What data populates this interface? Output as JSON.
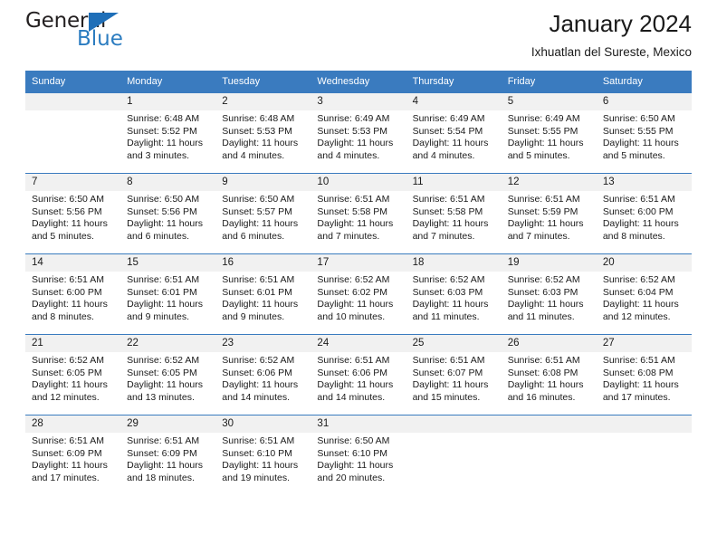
{
  "brand": {
    "name_part1": "General",
    "name_part2": "Blue",
    "triangle_color": "#1f6fb8",
    "blue_color": "#2b7cc0"
  },
  "header": {
    "title": "January 2024",
    "subtitle": "Ixhuatlan del Sureste, Mexico"
  },
  "theme": {
    "header_bg": "#3a7bbf",
    "daynum_bg": "#f1f1f1",
    "grid_line": "#3a7bbf",
    "text": "#1a1a1a"
  },
  "weekday_headers": [
    "Sunday",
    "Monday",
    "Tuesday",
    "Wednesday",
    "Thursday",
    "Friday",
    "Saturday"
  ],
  "weeks": [
    [
      {
        "day": "",
        "sunrise": "",
        "sunset": "",
        "daylight": "",
        "empty": true
      },
      {
        "day": "1",
        "sunrise": "Sunrise: 6:48 AM",
        "sunset": "Sunset: 5:52 PM",
        "daylight": "Daylight: 11 hours and 3 minutes."
      },
      {
        "day": "2",
        "sunrise": "Sunrise: 6:48 AM",
        "sunset": "Sunset: 5:53 PM",
        "daylight": "Daylight: 11 hours and 4 minutes."
      },
      {
        "day": "3",
        "sunrise": "Sunrise: 6:49 AM",
        "sunset": "Sunset: 5:53 PM",
        "daylight": "Daylight: 11 hours and 4 minutes."
      },
      {
        "day": "4",
        "sunrise": "Sunrise: 6:49 AM",
        "sunset": "Sunset: 5:54 PM",
        "daylight": "Daylight: 11 hours and 4 minutes."
      },
      {
        "day": "5",
        "sunrise": "Sunrise: 6:49 AM",
        "sunset": "Sunset: 5:55 PM",
        "daylight": "Daylight: 11 hours and 5 minutes."
      },
      {
        "day": "6",
        "sunrise": "Sunrise: 6:50 AM",
        "sunset": "Sunset: 5:55 PM",
        "daylight": "Daylight: 11 hours and 5 minutes."
      }
    ],
    [
      {
        "day": "7",
        "sunrise": "Sunrise: 6:50 AM",
        "sunset": "Sunset: 5:56 PM",
        "daylight": "Daylight: 11 hours and 5 minutes."
      },
      {
        "day": "8",
        "sunrise": "Sunrise: 6:50 AM",
        "sunset": "Sunset: 5:56 PM",
        "daylight": "Daylight: 11 hours and 6 minutes."
      },
      {
        "day": "9",
        "sunrise": "Sunrise: 6:50 AM",
        "sunset": "Sunset: 5:57 PM",
        "daylight": "Daylight: 11 hours and 6 minutes."
      },
      {
        "day": "10",
        "sunrise": "Sunrise: 6:51 AM",
        "sunset": "Sunset: 5:58 PM",
        "daylight": "Daylight: 11 hours and 7 minutes."
      },
      {
        "day": "11",
        "sunrise": "Sunrise: 6:51 AM",
        "sunset": "Sunset: 5:58 PM",
        "daylight": "Daylight: 11 hours and 7 minutes."
      },
      {
        "day": "12",
        "sunrise": "Sunrise: 6:51 AM",
        "sunset": "Sunset: 5:59 PM",
        "daylight": "Daylight: 11 hours and 7 minutes."
      },
      {
        "day": "13",
        "sunrise": "Sunrise: 6:51 AM",
        "sunset": "Sunset: 6:00 PM",
        "daylight": "Daylight: 11 hours and 8 minutes."
      }
    ],
    [
      {
        "day": "14",
        "sunrise": "Sunrise: 6:51 AM",
        "sunset": "Sunset: 6:00 PM",
        "daylight": "Daylight: 11 hours and 8 minutes."
      },
      {
        "day": "15",
        "sunrise": "Sunrise: 6:51 AM",
        "sunset": "Sunset: 6:01 PM",
        "daylight": "Daylight: 11 hours and 9 minutes."
      },
      {
        "day": "16",
        "sunrise": "Sunrise: 6:51 AM",
        "sunset": "Sunset: 6:01 PM",
        "daylight": "Daylight: 11 hours and 9 minutes."
      },
      {
        "day": "17",
        "sunrise": "Sunrise: 6:52 AM",
        "sunset": "Sunset: 6:02 PM",
        "daylight": "Daylight: 11 hours and 10 minutes."
      },
      {
        "day": "18",
        "sunrise": "Sunrise: 6:52 AM",
        "sunset": "Sunset: 6:03 PM",
        "daylight": "Daylight: 11 hours and 11 minutes."
      },
      {
        "day": "19",
        "sunrise": "Sunrise: 6:52 AM",
        "sunset": "Sunset: 6:03 PM",
        "daylight": "Daylight: 11 hours and 11 minutes."
      },
      {
        "day": "20",
        "sunrise": "Sunrise: 6:52 AM",
        "sunset": "Sunset: 6:04 PM",
        "daylight": "Daylight: 11 hours and 12 minutes."
      }
    ],
    [
      {
        "day": "21",
        "sunrise": "Sunrise: 6:52 AM",
        "sunset": "Sunset: 6:05 PM",
        "daylight": "Daylight: 11 hours and 12 minutes."
      },
      {
        "day": "22",
        "sunrise": "Sunrise: 6:52 AM",
        "sunset": "Sunset: 6:05 PM",
        "daylight": "Daylight: 11 hours and 13 minutes."
      },
      {
        "day": "23",
        "sunrise": "Sunrise: 6:52 AM",
        "sunset": "Sunset: 6:06 PM",
        "daylight": "Daylight: 11 hours and 14 minutes."
      },
      {
        "day": "24",
        "sunrise": "Sunrise: 6:51 AM",
        "sunset": "Sunset: 6:06 PM",
        "daylight": "Daylight: 11 hours and 14 minutes."
      },
      {
        "day": "25",
        "sunrise": "Sunrise: 6:51 AM",
        "sunset": "Sunset: 6:07 PM",
        "daylight": "Daylight: 11 hours and 15 minutes."
      },
      {
        "day": "26",
        "sunrise": "Sunrise: 6:51 AM",
        "sunset": "Sunset: 6:08 PM",
        "daylight": "Daylight: 11 hours and 16 minutes."
      },
      {
        "day": "27",
        "sunrise": "Sunrise: 6:51 AM",
        "sunset": "Sunset: 6:08 PM",
        "daylight": "Daylight: 11 hours and 17 minutes."
      }
    ],
    [
      {
        "day": "28",
        "sunrise": "Sunrise: 6:51 AM",
        "sunset": "Sunset: 6:09 PM",
        "daylight": "Daylight: 11 hours and 17 minutes."
      },
      {
        "day": "29",
        "sunrise": "Sunrise: 6:51 AM",
        "sunset": "Sunset: 6:09 PM",
        "daylight": "Daylight: 11 hours and 18 minutes."
      },
      {
        "day": "30",
        "sunrise": "Sunrise: 6:51 AM",
        "sunset": "Sunset: 6:10 PM",
        "daylight": "Daylight: 11 hours and 19 minutes."
      },
      {
        "day": "31",
        "sunrise": "Sunrise: 6:50 AM",
        "sunset": "Sunset: 6:10 PM",
        "daylight": "Daylight: 11 hours and 20 minutes."
      },
      {
        "day": "",
        "sunrise": "",
        "sunset": "",
        "daylight": "",
        "empty": true
      },
      {
        "day": "",
        "sunrise": "",
        "sunset": "",
        "daylight": "",
        "empty": true
      },
      {
        "day": "",
        "sunrise": "",
        "sunset": "",
        "daylight": "",
        "empty": true
      }
    ]
  ]
}
